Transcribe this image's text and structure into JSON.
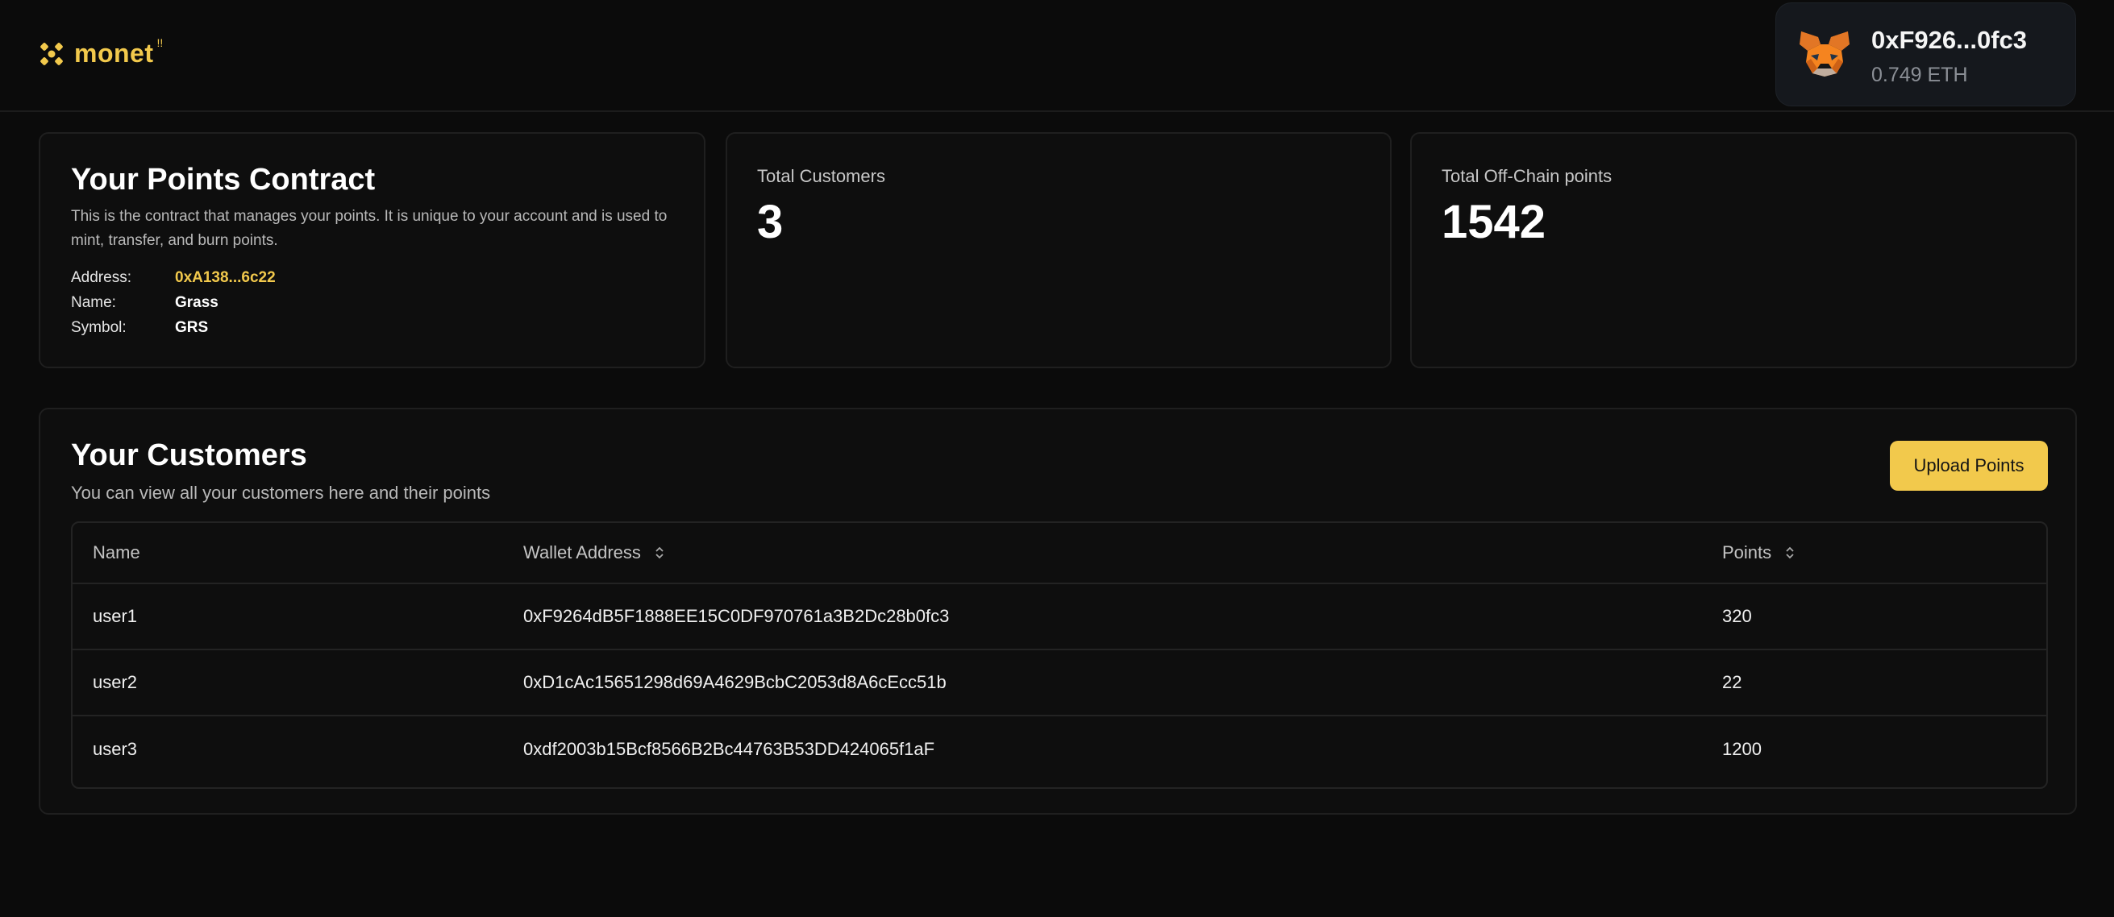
{
  "header": {
    "brand_name": "monet",
    "brand_sup": "!!",
    "wallet": {
      "address": "0xF926...0fc3",
      "balance": "0.749 ETH",
      "avatar_icon": "metamask-fox-icon"
    }
  },
  "contract_card": {
    "title": "Your Points Contract",
    "description": "This is the contract that manages your points. It is unique to your account and is used to mint, transfer, and burn points.",
    "address_label": "Address:",
    "address_value": "0xA138...6c22",
    "name_label": "Name:",
    "name_value": "Grass",
    "symbol_label": "Symbol:",
    "symbol_value": "GRS"
  },
  "stats": {
    "customers_label": "Total Customers",
    "customers_value": "3",
    "points_label": "Total Off-Chain points",
    "points_value": "1542"
  },
  "customers": {
    "title": "Your Customers",
    "subtitle": "You can view all your customers here and their points",
    "upload_label": "Upload Points",
    "columns": {
      "name": "Name",
      "wallet": "Wallet Address",
      "points": "Points"
    },
    "rows": [
      {
        "name": "user1",
        "wallet": "0xF9264dB5F1888EE15C0DF970761a3B2Dc28b0fc3",
        "points": "320"
      },
      {
        "name": "user2",
        "wallet": "0xD1cAc15651298d69A4629BcbC2053d8A6cEcc51b",
        "points": "22"
      },
      {
        "name": "user3",
        "wallet": "0xdf2003b15Bcf8566B2Bc44763B53DD424065f1aF",
        "points": "1200"
      }
    ]
  },
  "colors": {
    "background": "#0b0b0b",
    "accent": "#f2c94c",
    "card": "#0e0e0e",
    "border": "#1f1f1f"
  }
}
